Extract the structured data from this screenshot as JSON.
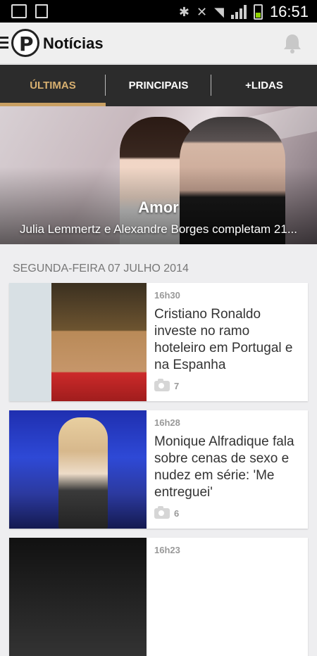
{
  "status": {
    "time": "16:51"
  },
  "appbar": {
    "title": "Notícias",
    "bell_icon": "bell-icon"
  },
  "tabs": [
    {
      "label": "ÚLTIMAS",
      "active": true
    },
    {
      "label": "PRINCIPAIS",
      "active": false
    },
    {
      "label": "+LIDAS",
      "active": false
    }
  ],
  "hero": {
    "title": "Amor",
    "subtitle": "Julia Lemmertz e Alexandre Borges completam 21..."
  },
  "date_header": "SEGUNDA-FEIRA 07 JULHO 2014",
  "articles": [
    {
      "time": "16h30",
      "title": "Cristiano Ronaldo investe no ramo hoteleiro em Portugal e na Espanha",
      "photos": "7"
    },
    {
      "time": "16h28",
      "title": "Monique Alfradique fala sobre cenas de sexo e nudez em série: 'Me entreguei'",
      "photos": "6"
    },
    {
      "time": "16h23",
      "title": "",
      "photos": ""
    }
  ],
  "colors": {
    "accent": "#c9a063",
    "tabbar": "#2c2c2c",
    "appbar": "#efefef"
  }
}
